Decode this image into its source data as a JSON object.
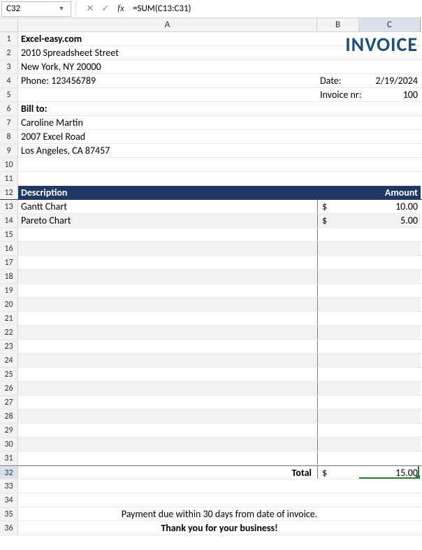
{
  "formulaBar": {
    "nameBox": "C32",
    "formula": "=SUM(C13:C31)"
  },
  "columns": [
    "A",
    "B",
    "C"
  ],
  "company": {
    "name": "Excel-easy.com",
    "street": "2010 Spreadsheet Street",
    "cityzip": "New York, NY 20000",
    "phone": "Phone: 123456789"
  },
  "invoiceTitle": "INVOICE",
  "meta": {
    "dateLabel": "Date:",
    "dateValue": "2/19/2024",
    "invoiceNrLabel": "Invoice nr:",
    "invoiceNrValue": "100"
  },
  "billTo": {
    "label": "Bill to:",
    "name": "Caroline Martin",
    "street": "2007 Excel Road",
    "cityzip": "Los Angeles, CA 87457"
  },
  "tableHeader": {
    "description": "Description",
    "amount": "Amount"
  },
  "items": [
    {
      "desc": "Gantt Chart",
      "symbol": "$",
      "amount": "10.00"
    },
    {
      "desc": "Pareto Chart",
      "symbol": "$",
      "amount": "5.00"
    }
  ],
  "totalLabel": "Total",
  "totalSymbol": "$",
  "totalValue": "15.00",
  "footer": {
    "line1": "Payment due within 30 days from date of invoice.",
    "line2": "Thank you for your business!"
  },
  "rowNumbers": [
    1,
    2,
    3,
    4,
    5,
    6,
    7,
    8,
    9,
    10,
    11,
    12,
    13,
    14,
    15,
    16,
    17,
    18,
    19,
    20,
    21,
    22,
    23,
    24,
    25,
    26,
    27,
    28,
    29,
    30,
    31,
    32,
    33,
    34,
    35,
    36
  ],
  "selectedRow": 32,
  "selectedCol": "C"
}
